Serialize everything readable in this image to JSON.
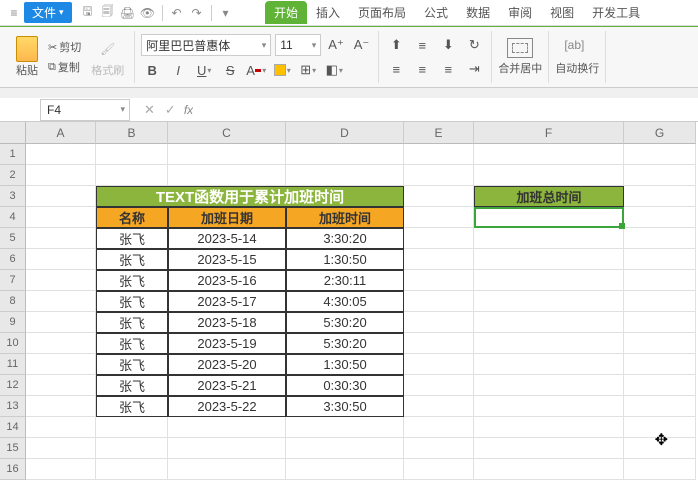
{
  "titlebar": {
    "file_label": "文件"
  },
  "tabs": {
    "start": "开始",
    "insert": "插入",
    "layout": "页面布局",
    "formula": "公式",
    "data": "数据",
    "review": "审阅",
    "view": "视图",
    "dev": "开发工具"
  },
  "ribbon": {
    "paste": "粘贴",
    "cut": "剪切",
    "copy": "复制",
    "format_painter": "格式刷",
    "font_name": "阿里巴巴普惠体",
    "font_size": "11",
    "merge_center": "合并居中",
    "auto_wrap": "自动换行"
  },
  "namebox": {
    "value": "F4"
  },
  "columns": [
    "A",
    "B",
    "C",
    "D",
    "E",
    "F",
    "G"
  ],
  "sheet": {
    "merged_title": "TEXT函数用于累计加班时间",
    "headers": {
      "name": "名称",
      "date": "加班日期",
      "time": "加班时间"
    },
    "f_header": "加班总时间",
    "rows": [
      {
        "name": "张飞",
        "date": "2023-5-14",
        "time": "3:30:20"
      },
      {
        "name": "张飞",
        "date": "2023-5-15",
        "time": "1:30:50"
      },
      {
        "name": "张飞",
        "date": "2023-5-16",
        "time": "2:30:11"
      },
      {
        "name": "张飞",
        "date": "2023-5-17",
        "time": "4:30:05"
      },
      {
        "name": "张飞",
        "date": "2023-5-18",
        "time": "5:30:20"
      },
      {
        "name": "张飞",
        "date": "2023-5-19",
        "time": "5:30:20"
      },
      {
        "name": "张飞",
        "date": "2023-5-20",
        "time": "1:30:50"
      },
      {
        "name": "张飞",
        "date": "2023-5-21",
        "time": "0:30:30"
      },
      {
        "name": "张飞",
        "date": "2023-5-22",
        "time": "3:30:50"
      }
    ]
  }
}
